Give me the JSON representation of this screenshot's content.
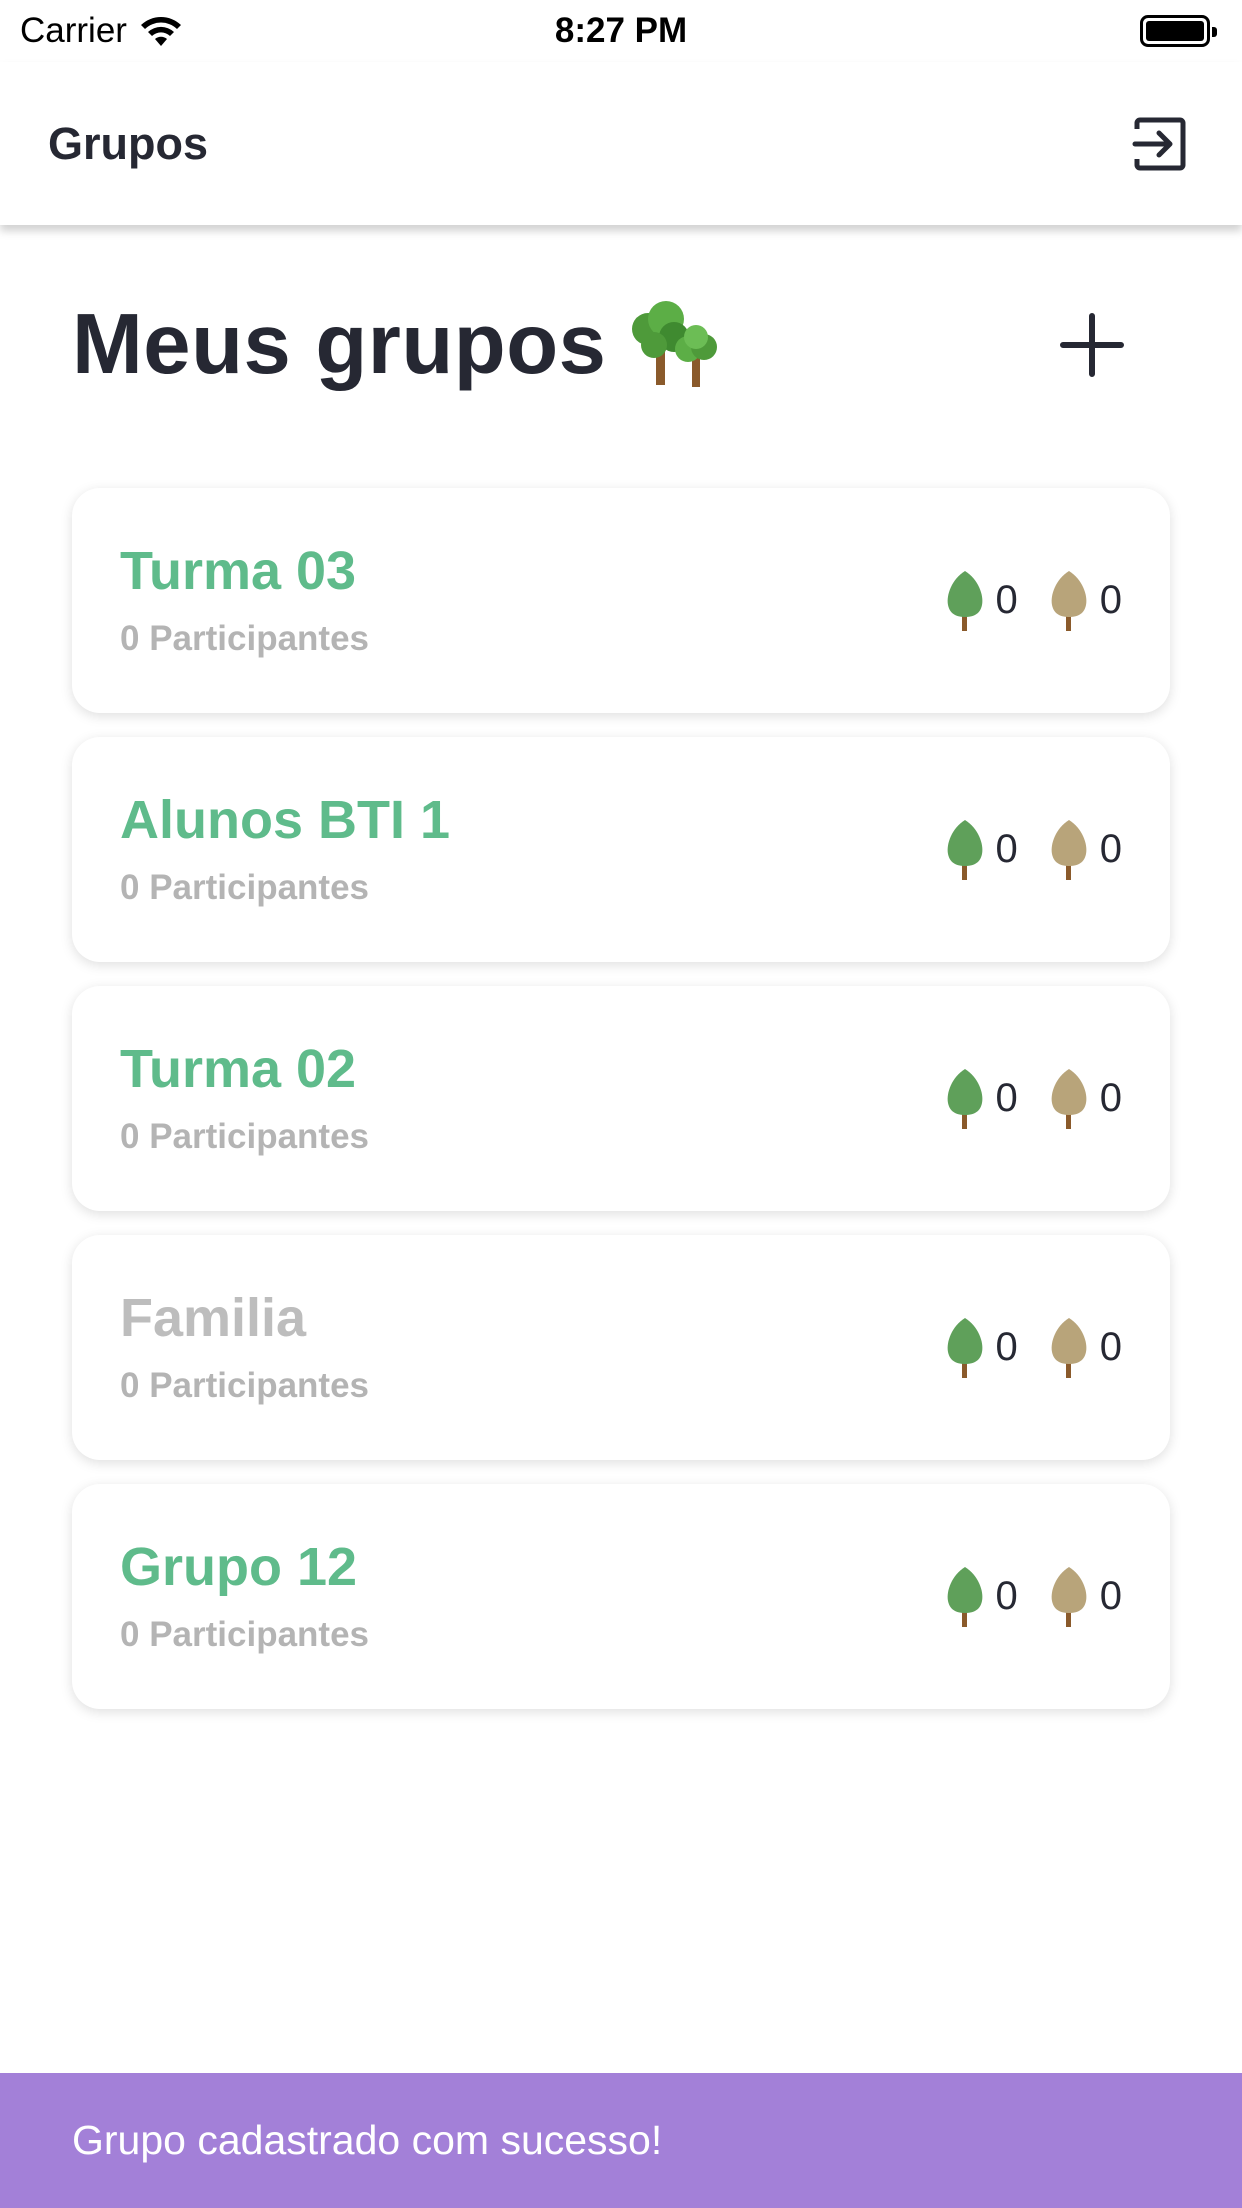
{
  "status_bar": {
    "carrier": "Carrier",
    "time": "8:27 PM"
  },
  "header": {
    "title": "Grupos",
    "logout_icon": "logout-icon"
  },
  "page": {
    "title": "Meus grupos",
    "title_icon": "trees-emoji-icon",
    "add_icon": "plus-icon"
  },
  "groups": [
    {
      "name": "Turma 03",
      "participants": "0 Participantes",
      "green_count": "0",
      "brown_count": "0",
      "active": true
    },
    {
      "name": "Alunos BTI 1",
      "participants": "0 Participantes",
      "green_count": "0",
      "brown_count": "0",
      "active": true
    },
    {
      "name": "Turma 02",
      "participants": "0 Participantes",
      "green_count": "0",
      "brown_count": "0",
      "active": true
    },
    {
      "name": "Familia",
      "participants": "0 Participantes",
      "green_count": "0",
      "brown_count": "0",
      "active": false
    },
    {
      "name": "Grupo 12",
      "participants": "0 Participantes",
      "green_count": "0",
      "brown_count": "0",
      "active": true
    }
  ],
  "toast": {
    "message": "Grupo cadastrado com sucesso!"
  },
  "colors": {
    "accent_green": "#5fbb8b",
    "muted_gray": "#bdbdbd",
    "toast_purple": "#a380d8",
    "text_dark": "#262833"
  }
}
